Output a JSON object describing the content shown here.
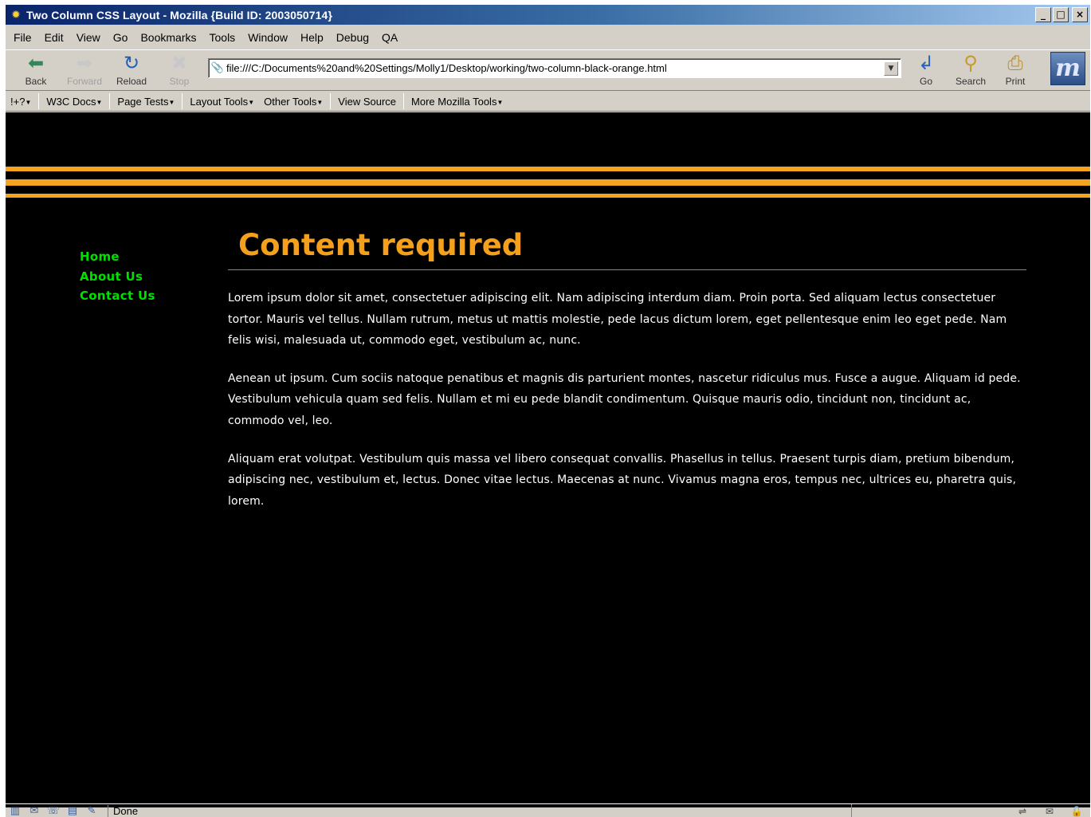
{
  "window": {
    "title": "Two Column CSS Layout - Mozilla {Build ID: 2003050714}",
    "controls": [
      "_",
      "□",
      "×"
    ]
  },
  "menubar": [
    "File",
    "Edit",
    "View",
    "Go",
    "Bookmarks",
    "Tools",
    "Window",
    "Help",
    "Debug",
    "QA"
  ],
  "navbar": {
    "back": "Back",
    "forward": "Forward",
    "reload": "Reload",
    "stop": "Stop",
    "url": "file:///C:/Documents%20and%20Settings/Molly1/Desktop/working/two-column-black-orange.html",
    "go": "Go",
    "search": "Search",
    "print": "Print"
  },
  "personal_toolbar": [
    "!+?",
    "W3C Docs",
    "Page Tests",
    "Layout Tools",
    "Other Tools",
    "View Source",
    "More Mozilla Tools"
  ],
  "page": {
    "nav": [
      "Home",
      "About Us",
      "Contact Us"
    ],
    "heading": "Content required",
    "paragraphs": [
      "Lorem ipsum dolor sit amet, consectetuer adipiscing elit. Nam adipiscing interdum diam. Proin porta. Sed aliquam lectus consectetuer tortor. Mauris vel tellus. Nullam rutrum, metus ut mattis molestie, pede lacus dictum lorem, eget pellentesque enim leo eget pede. Nam felis wisi, malesuada ut, commodo eget, vestibulum ac, nunc.",
      "Aenean ut ipsum. Cum sociis natoque penatibus et magnis dis parturient montes, nascetur ridiculus mus. Fusce a augue. Aliquam id pede. Vestibulum vehicula quam sed felis. Nullam et mi eu pede blandit condimentum. Quisque mauris odio, tincidunt non, tincidunt ac, commodo vel, leo.",
      "Aliquam erat volutpat. Vestibulum quis massa vel libero consequat convallis. Phasellus in tellus. Praesent turpis diam, pretium bibendum, adipiscing nec, vestibulum et, lectus. Donec vitae lectus. Maecenas at nunc. Vivamus magna eros, tempus nec, ultrices eu, pharetra quis, lorem."
    ],
    "colors": {
      "background": "#000000",
      "accent": "#f4a41e",
      "nav_link": "#00e000",
      "text": "#ffffff"
    }
  },
  "statusbar": {
    "text": "Done"
  },
  "icons": [
    "mozilla-app-icon",
    "back-arrow-icon",
    "forward-arrow-icon",
    "reload-icon",
    "stop-icon",
    "bookmark-pin-icon",
    "go-icon",
    "search-icon",
    "print-icon",
    "mozilla-logo-icon"
  ]
}
